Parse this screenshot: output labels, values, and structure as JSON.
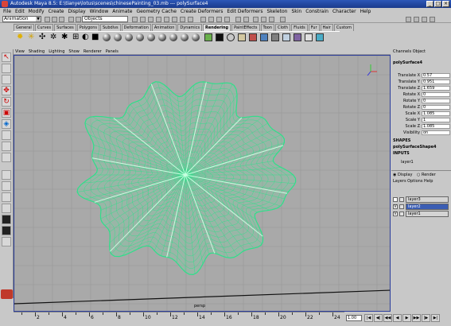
{
  "window": {
    "title": "Autodesk Maya 8.5: E:\\tianye\\lotus\\scenes\\chinesePainting_03.mb  ---  polySurface4",
    "controls": [
      "_",
      "□",
      "×"
    ]
  },
  "menubar": [
    "File",
    "Edit",
    "Modify",
    "Create",
    "Display",
    "Window",
    "Animate",
    "Geometry Cache",
    "Create Deformers",
    "Edit Deformers",
    "Skeleton",
    "Skin",
    "Constrain",
    "Character",
    "Help"
  ],
  "statusline": {
    "mode": "Animation",
    "objects_field": "Objects"
  },
  "shelf_tabs": [
    "General",
    "Curves",
    "Surfaces",
    "Polygons",
    "Subdivs",
    "Deformation",
    "Animation",
    "Dynamics",
    "Rendering",
    "PaintEffects",
    "Toon",
    "Cloth",
    "Fluids",
    "Fur",
    "Hair",
    "Custom"
  ],
  "active_shelf_tab": "Rendering",
  "panel_menu": [
    "View",
    "Shading",
    "Lighting",
    "Show",
    "Renderer",
    "Panels"
  ],
  "viewport": {
    "camera_label": "persp",
    "mesh_color": "#2fe08a",
    "background": "#a9a9a9"
  },
  "channelbox": {
    "tabs": [
      "Channels",
      "Object"
    ],
    "object_name": "polySurface4",
    "attributes": [
      {
        "label": "Translate X",
        "value": "0.57"
      },
      {
        "label": "Translate Y",
        "value": "0.951"
      },
      {
        "label": "Translate Z",
        "value": "1.659"
      },
      {
        "label": "Rotate X",
        "value": "0"
      },
      {
        "label": "Rotate Y",
        "value": "0"
      },
      {
        "label": "Rotate Z",
        "value": "0"
      },
      {
        "label": "Scale X",
        "value": "1.085"
      },
      {
        "label": "Scale Y",
        "value": "1"
      },
      {
        "label": "Scale Z",
        "value": "1.085"
      },
      {
        "label": "Visibility",
        "value": "on"
      }
    ],
    "shapes_header": "SHAPES",
    "shape_name": "polySurfaceShape4",
    "inputs_header": "INPUTS",
    "input_name": "layer1"
  },
  "layer_editor": {
    "mode_display": "Display",
    "mode_render": "Render",
    "menu": [
      "Layers",
      "Options",
      "Help"
    ],
    "layers": [
      {
        "name": "layer3",
        "visible": "",
        "selected": false
      },
      {
        "name": "layer2",
        "visible": "V",
        "selected": true
      },
      {
        "name": "layer1",
        "visible": "V",
        "selected": false
      }
    ]
  },
  "timeline": {
    "tick_labels": [
      "2",
      "4",
      "6",
      "8",
      "10",
      "12",
      "14",
      "16",
      "18",
      "20",
      "22",
      "24"
    ],
    "current_frame": "1.00",
    "playback_buttons": [
      "|◀",
      "◀|",
      "◀◀",
      "◀",
      "▶",
      "▶▶",
      "|▶",
      "▶|"
    ]
  }
}
